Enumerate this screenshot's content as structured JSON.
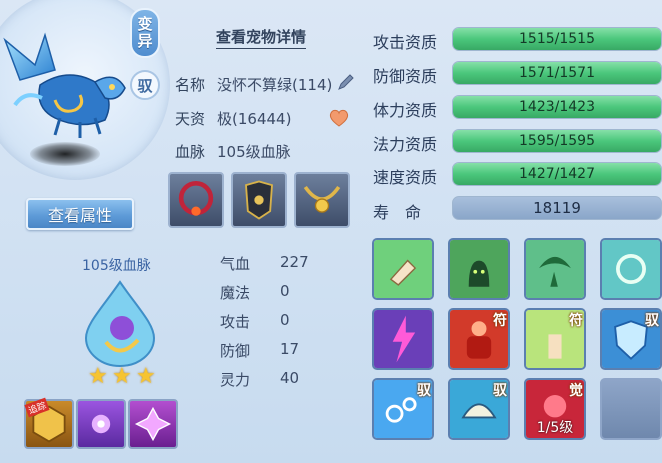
{
  "header": {
    "detail_link": "查看宠物详情"
  },
  "badges": {
    "change": "变异",
    "ride": "驭"
  },
  "buttons": {
    "view_attributes": "查看属性"
  },
  "info": [
    {
      "label": "名称",
      "value": "没怀不算绿(114)"
    },
    {
      "label": "天资",
      "value": "极(16444)"
    },
    {
      "label": "血脉",
      "value": "105级血脉"
    }
  ],
  "lineage": {
    "label": "105级血脉",
    "stars": [
      "★",
      "★",
      "★"
    ]
  },
  "stats": [
    {
      "label": "气血",
      "value": "227"
    },
    {
      "label": "魔法",
      "value": "0"
    },
    {
      "label": "攻击",
      "value": "0"
    },
    {
      "label": "防御",
      "value": "17"
    },
    {
      "label": "灵力",
      "value": "40"
    }
  ],
  "aptitudes": [
    {
      "label": "攻击资质",
      "value": "1515/1515",
      "fill": 1.0
    },
    {
      "label": "防御资质",
      "value": "1571/1571",
      "fill": 1.0
    },
    {
      "label": "体力资质",
      "value": "1423/1423",
      "fill": 1.0
    },
    {
      "label": "法力资质",
      "value": "1595/1595",
      "fill": 1.0
    },
    {
      "label": "速度资质",
      "value": "1427/1427",
      "fill": 1.0
    }
  ],
  "life": {
    "label": "寿　命",
    "value": "18119"
  },
  "skills": {
    "tags": {
      "fu": "符",
      "yu": "驭",
      "jue": "觉"
    },
    "awaken_level": "1/5级",
    "colors": [
      "#6fd07c",
      "#4ea55c",
      "#5fbf8a",
      "#62c7c6",
      "#6a3fb8",
      "#d23a2a",
      "#b9e47c",
      "#3c8fd6",
      "#4aa8f0",
      "#3aa8d8",
      "#c8263a"
    ]
  },
  "bottom_slots": {
    "badge": "追踪"
  },
  "colors": {
    "accent_blue": "#5e9bd8",
    "apt_green": "#4bc77c",
    "label_dark": "#2c3e5c"
  }
}
